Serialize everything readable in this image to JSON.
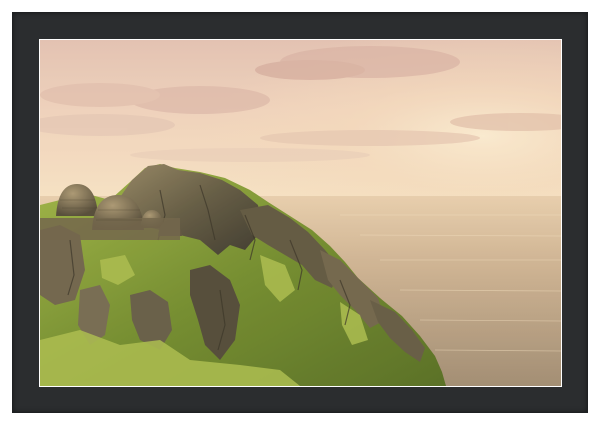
{
  "artwork": {
    "subject": "skellig-michael-beehive-huts-at-sunset",
    "frame_color": "#2b2d2f",
    "mat_color": "#ffffff",
    "palette": {
      "sky_top": "#e9c7b7",
      "sky_glow": "#f6e3c7",
      "sea": "#c7ad8e",
      "sea_highlight": "#efd8b4",
      "grass": "#6f8f2d",
      "grass_lit": "#a6b84a",
      "rock_dark": "#3c3a2f",
      "rock_lit": "#8a7a5a"
    }
  }
}
